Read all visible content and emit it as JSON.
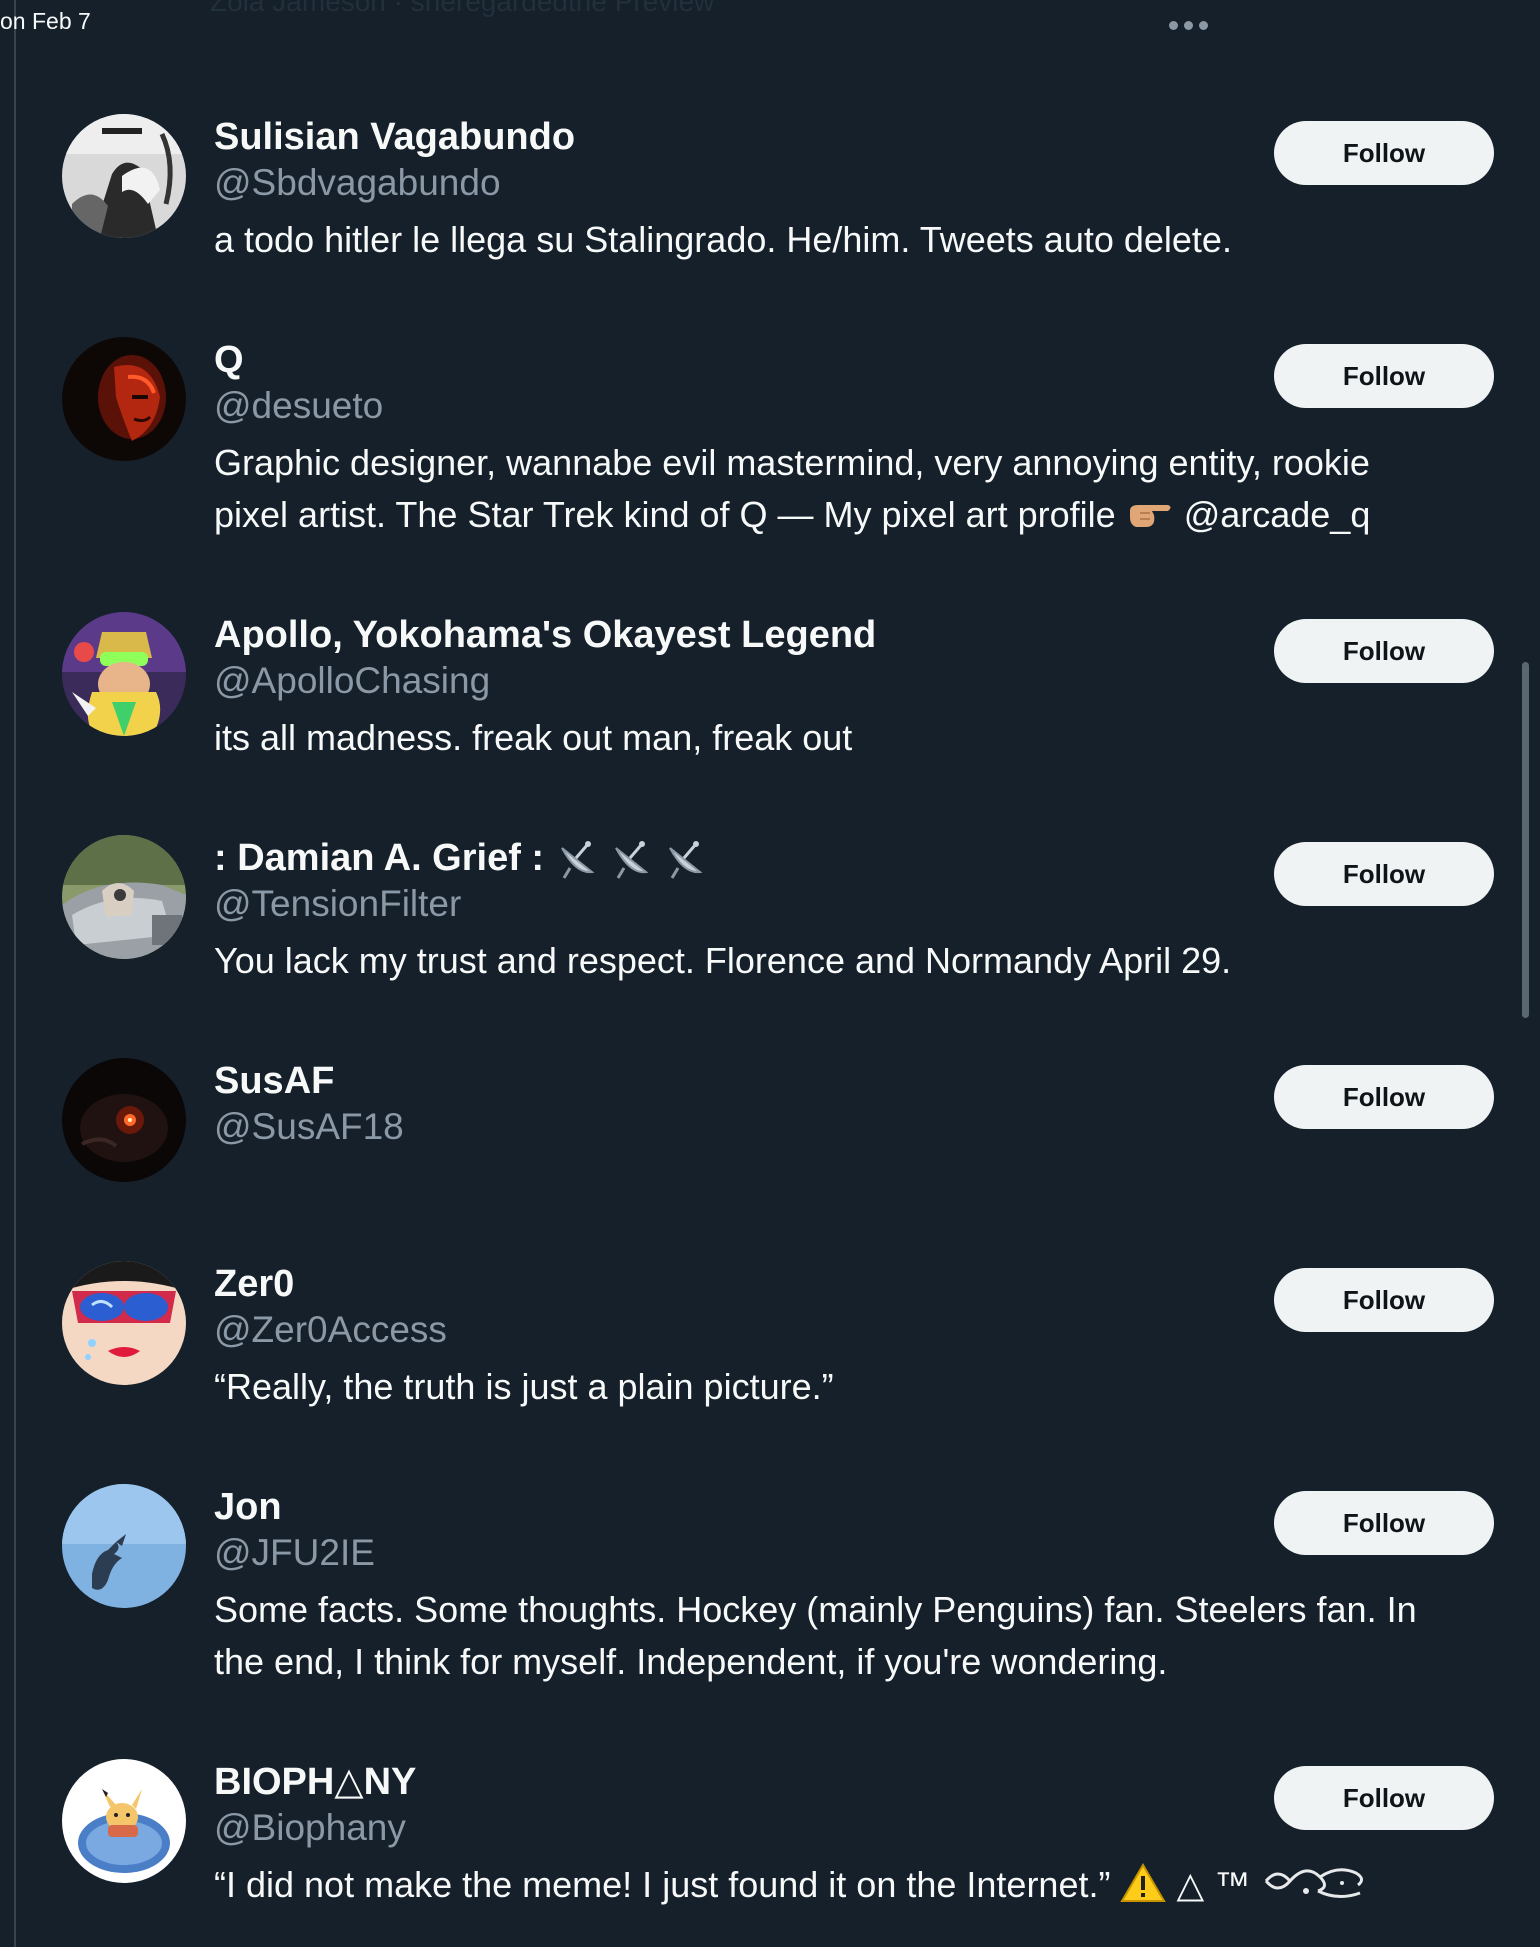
{
  "top_bar": {
    "date": "on Feb 7",
    "faded_text": "Zola Jameson  ·  sheregardedthe Preview"
  },
  "users": [
    {
      "name": "Sulisian Vagabundo",
      "handle": "@Sbdvagabundo",
      "bio": "a todo hitler le llega su Stalingrado. He/him. Tweets auto delete.",
      "follow_label": "Follow",
      "avatar_icon": "bw-portrait-avatar"
    },
    {
      "name": "Q",
      "handle": "@desueto",
      "bio_line1": "Graphic designer, wannabe evil mastermind, very annoying entity, rookie",
      "bio_line2": "pixel artist. The Star Trek kind of Q — My pixel art profile",
      "bio_mention": "@arcade_q",
      "follow_label": "Follow",
      "avatar_icon": "red-lit-face-avatar"
    },
    {
      "name": "Apollo, Yokohama's Okayest Legend",
      "handle": "@ApolloChasing",
      "bio": "its all madness. freak out man, freak out",
      "follow_label": "Follow",
      "avatar_icon": "colorful-wrestler-avatar"
    },
    {
      "name": ": Damian A. Grief :",
      "handle": "@TensionFilter",
      "bio": "You lack my trust and respect. Florence and Normandy April 29.",
      "follow_label": "Follow",
      "avatar_icon": "car-window-avatar"
    },
    {
      "name": "SusAF",
      "handle": "@SusAF18",
      "follow_label": "Follow",
      "avatar_icon": "dark-glow-avatar"
    },
    {
      "name": "Zer0",
      "handle": "@Zer0Access",
      "bio": "“Really, the truth is just a plain picture.”",
      "follow_label": "Follow",
      "avatar_icon": "pop-art-face-avatar"
    },
    {
      "name": "Jon",
      "handle": "@JFU2IE",
      "bio_line1": "Some facts. Some thoughts. Hockey (mainly Penguins) fan. Steelers fan. In",
      "bio_line2": "the end, I think for myself. Independent, if you're wondering.",
      "follow_label": "Follow",
      "avatar_icon": "sky-bird-avatar"
    },
    {
      "name": "BIOPH△NY",
      "handle": "@Biophany",
      "bio": "“I did not make the meme! I just found it on the Internet.”",
      "bio_symbols": "△ ™",
      "follow_label": "Follow",
      "avatar_icon": "cartoon-pikachu-avatar"
    }
  ],
  "colors": {
    "background": "#15202b",
    "primary_text": "#f7f9f9",
    "secondary_text": "#8b98a5",
    "follow_button_bg": "#eff3f4",
    "follow_button_text": "#0f1419"
  }
}
